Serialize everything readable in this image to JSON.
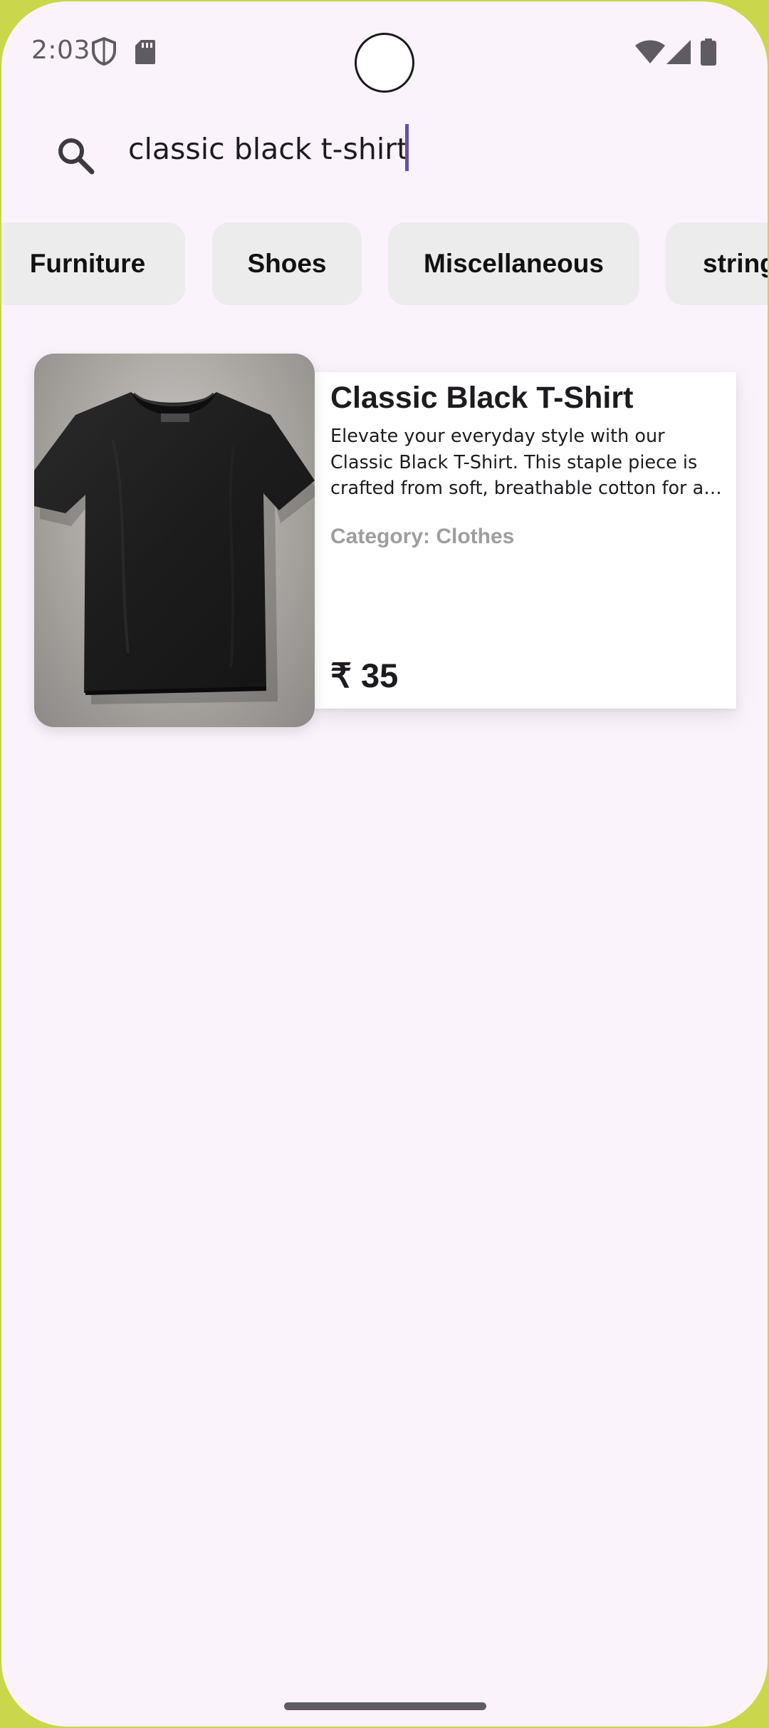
{
  "status_bar": {
    "time": "2:03",
    "icons": [
      "shield-icon",
      "sd-card-icon",
      "wifi-icon",
      "cellular-signal-icon",
      "battery-icon"
    ]
  },
  "search": {
    "value": "classic black t-shirt",
    "icon": "search-icon",
    "caret_color": "#6750a4"
  },
  "categories": [
    {
      "label": "Furniture"
    },
    {
      "label": "Shoes"
    },
    {
      "label": "Miscellaneous"
    },
    {
      "label": "string"
    }
  ],
  "product": {
    "title": "Classic Black T-Shirt",
    "description": "Elevate your everyday style with our Classic Black T-Shirt. This staple piece is crafted from soft, breathable cotton for all-day co…",
    "category_text": "Category: Clothes",
    "price": "₹ 35",
    "image": "black-tshirt-photo"
  },
  "colors": {
    "background": "#fbf3fb",
    "chip_background": "#ececec",
    "accent": "#6750a4",
    "category_text": "#9e9e9e"
  }
}
